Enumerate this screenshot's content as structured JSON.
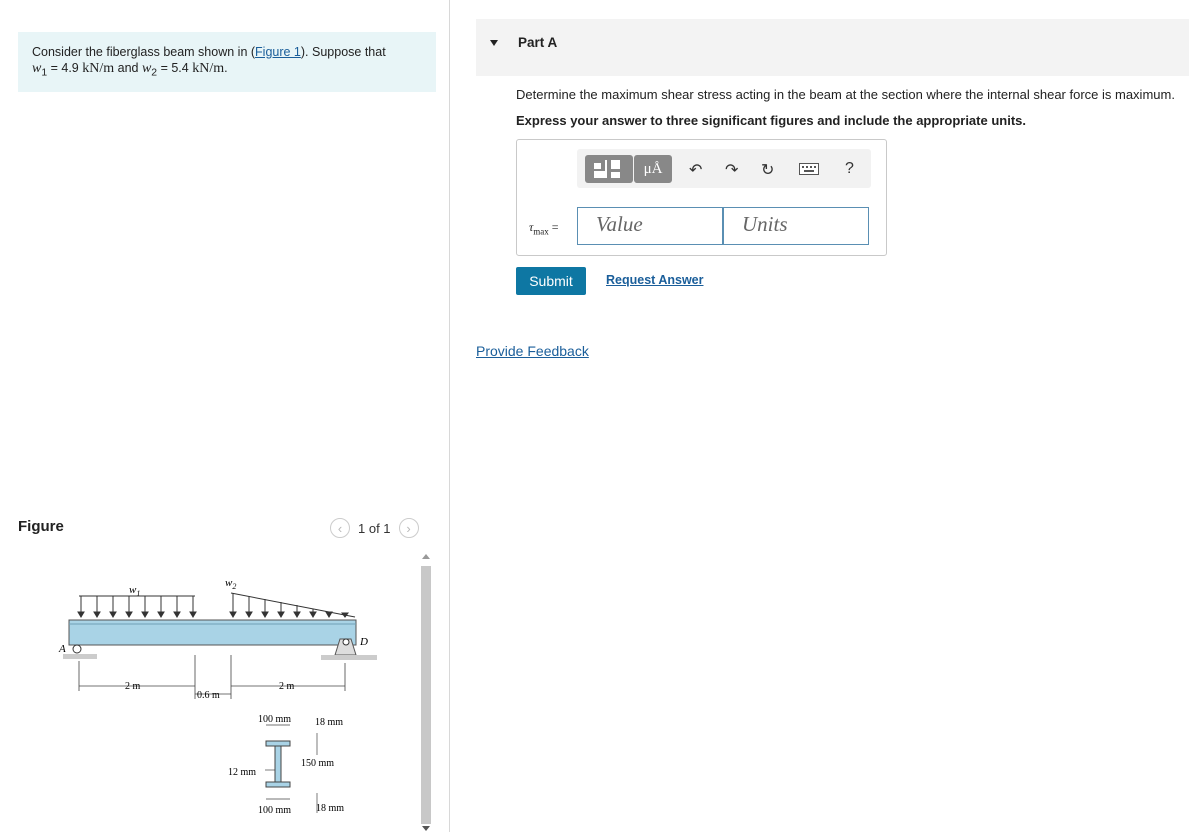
{
  "problem": {
    "prefix": "Consider the fiberglass beam shown in (",
    "figure_link": "Figure 1",
    "suffix": "). Suppose that",
    "w1_symbol": "w",
    "w1_sub": "1",
    "eq": " = 4.9 ",
    "w1_unit": "kN/m",
    "and": " and ",
    "w2_symbol": "w",
    "w2_sub": "2",
    "eq2": " = 5.4 ",
    "w2_unit": "kN/m",
    "end": "."
  },
  "figure": {
    "title": "Figure",
    "pager_text": "1 of 1",
    "prev_icon": "chevron-left-icon",
    "next_icon": "chevron-right-icon",
    "labels": {
      "w1": "w",
      "w1_sub": "1",
      "w2": "w",
      "w2_sub": "2",
      "A": "A",
      "D": "D",
      "dim1": "2 m",
      "dim2": "0.6 m",
      "dim3": "2 m",
      "flange_width_top": "100 mm",
      "flange_thk_top": "18 mm",
      "web_height": "150 mm",
      "web_thk": "12 mm",
      "flange_width_bot": "100 mm",
      "flange_thk_bot": "18 mm"
    }
  },
  "part": {
    "label": "Part A",
    "question": "Determine the maximum shear stress acting in the beam at the section where the internal shear force is maximum.",
    "instruction": "Express your answer to three significant figures and include the appropriate units."
  },
  "answer": {
    "tau_symbol": "τ",
    "tau_sub": "max",
    "equals": " =",
    "value_placeholder": "Value",
    "units_placeholder": "Units",
    "unit_btn": "μÅ",
    "help": "?"
  },
  "buttons": {
    "submit": "Submit",
    "request_answer": "Request Answer",
    "provide_feedback": "Provide Feedback"
  }
}
